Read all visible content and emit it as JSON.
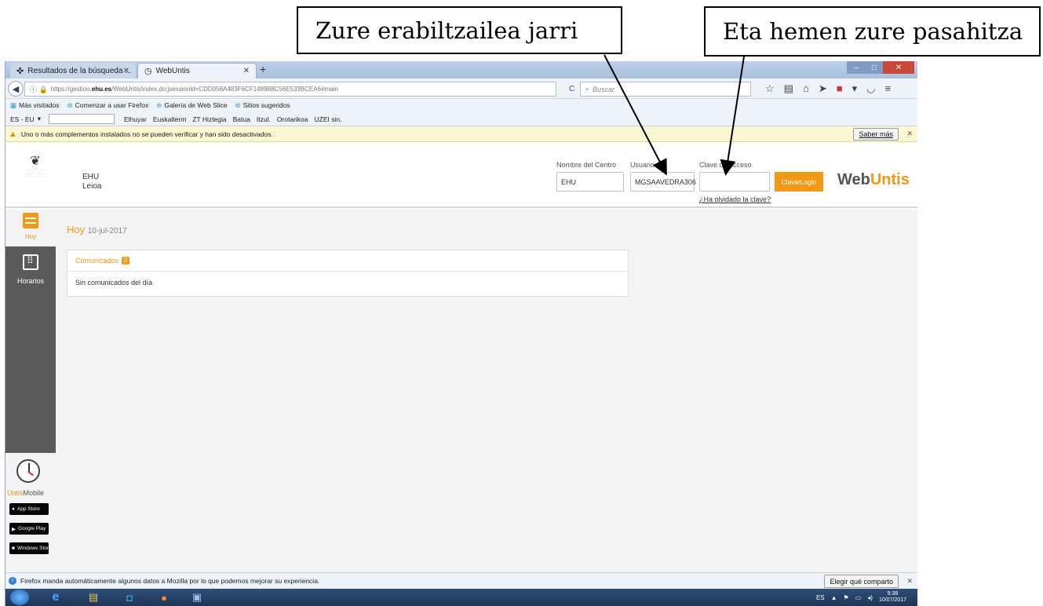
{
  "annotations": {
    "username_callout": "Zure erabiltzailea  jarri",
    "password_callout": "Eta hemen zure pasahitza"
  },
  "browser": {
    "tabs": [
      {
        "label": "Resultados de la búsqueda ..."
      },
      {
        "label": "WebUntis"
      }
    ],
    "url_prefix": "https://gestion.",
    "url_host": "ehu.es",
    "url_rest": "/WebUntis/index.do;jsessionid=CDD056A483F6CF148988C56E533BCEA6#main",
    "search_placeholder": "Buscar",
    "bookmarks": [
      "Más visitados",
      "Comenzar a usar Firefox",
      "Galería de Web Slice",
      "Sitios sugeridos"
    ],
    "lang_selector": "ES - EU",
    "lang_links": [
      "Elhuyar",
      "Euskalterm",
      "ZT Hiztegia",
      "Batua",
      "Itzul.",
      "Orotarikoa",
      "UZEI sin."
    ],
    "notification": "Uno o más complementos instalados no se pueden verificar y han sido desactivados.",
    "notification_button": "Saber más",
    "bottom_notification": "Firefox manda automáticamente algunos datos a Mozilla por lo que podemos mejorar su experiencia.",
    "bottom_button": "Elegir qué comparto"
  },
  "header": {
    "school_name": "EHU",
    "school_city": "Leioa",
    "center_label": "Nombre del Centro",
    "center_value": "EHU",
    "user_label": "Usuario",
    "user_value": "MGSAAVEDRA306",
    "password_label": "Clave de acceso",
    "password_value": "",
    "login_button": "Clave/Login",
    "forgot_link": "¿Ha olvidado la clave?",
    "brand_web": "Web",
    "brand_untis": "Untis"
  },
  "sidebar": {
    "items": [
      {
        "label": "Hoy"
      },
      {
        "label": "Horarios"
      }
    ],
    "mobile_untis": "Untis",
    "mobile_label": "Mobile",
    "stores": [
      "App Store",
      "Google Play",
      "Windows Store"
    ]
  },
  "main": {
    "title": "Hoy",
    "date": "10-jul-2017",
    "card_title": "Comunicados",
    "card_body": "Sin comunicados del día"
  },
  "taskbar": {
    "lang": "ES",
    "time": "9:38",
    "date": "10/07/2017"
  },
  "colors": {
    "accent": "#f29a15",
    "sidebar_dark": "#5a5a5a"
  }
}
